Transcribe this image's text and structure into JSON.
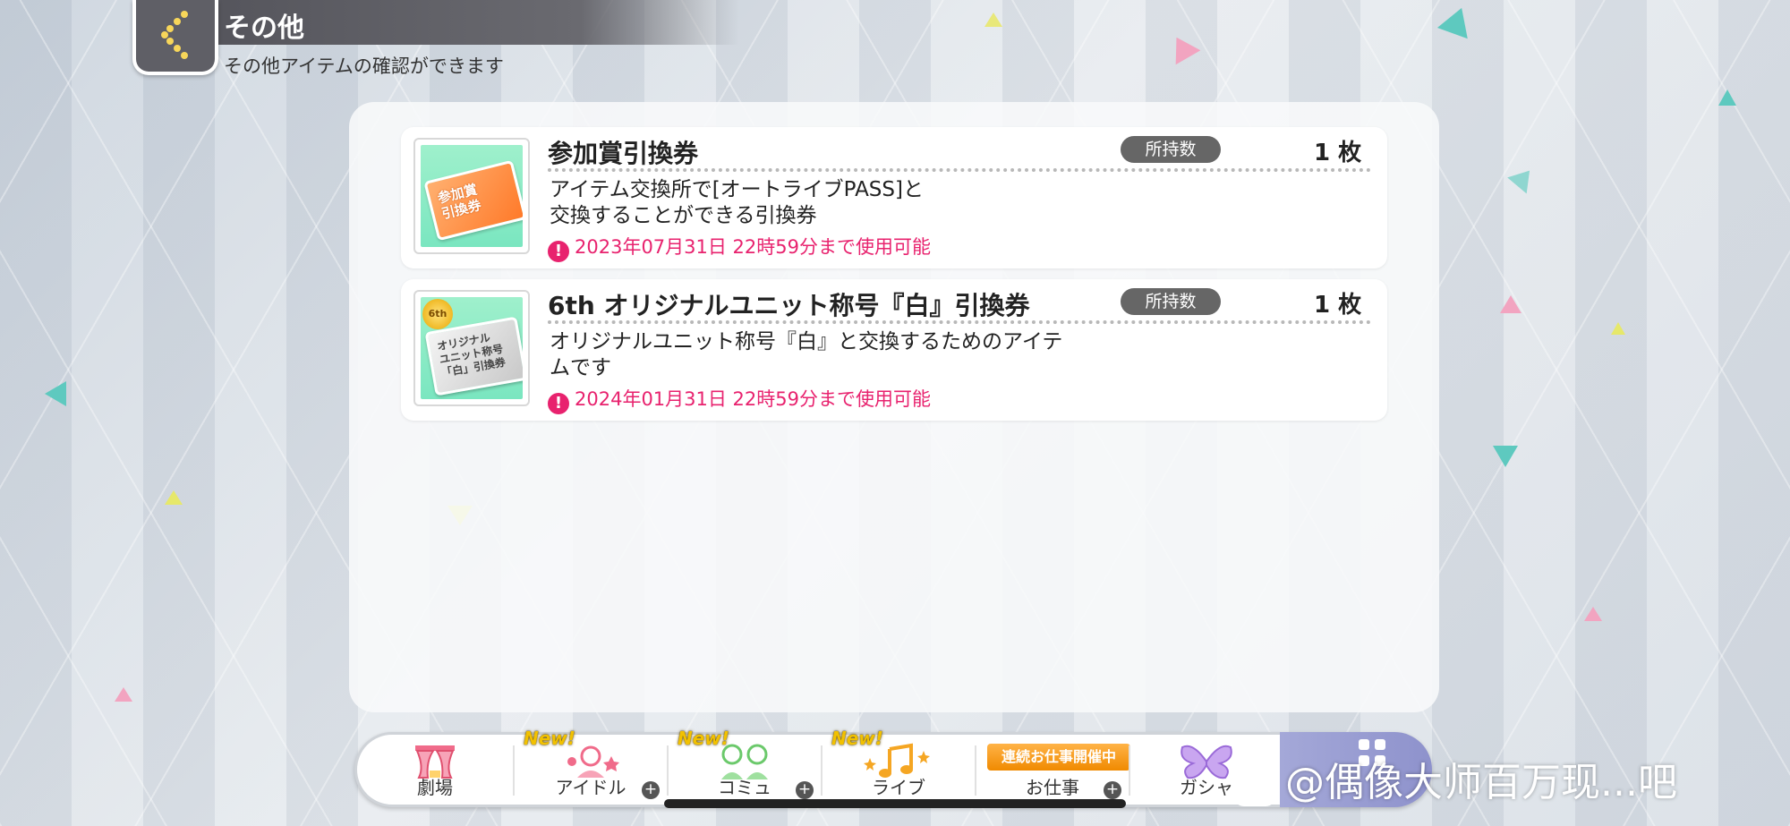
{
  "header": {
    "title": "その他",
    "subtitle": "その他アイテムの確認ができます"
  },
  "items": [
    {
      "name": "参加賞引換券",
      "held_label": "所持数",
      "count": "1 枚",
      "description_line1": "アイテム交換所で[オートライブPASS]と",
      "description_line2": "交換することができる引換券",
      "expiry": "2023年07月31日 22時59分まで使用可能",
      "thumb_text": "参加賞\n引換券",
      "icon": "ticket-icon"
    },
    {
      "name": "6th オリジナルユニット称号『白』引換券",
      "held_label": "所持数",
      "count": "1 枚",
      "description_line1": "オリジナルユニット称号『白』と交換するためのアイテ",
      "description_line2": "ムです",
      "expiry": "2024年01月31日 22時59分まで使用可能",
      "thumb_text": "オリジナル\nユニット称号\n「白」引換券",
      "thumb_badge": "6th",
      "icon": "ticket-icon"
    }
  ],
  "nav": {
    "items": [
      {
        "label": "劇場",
        "icon": "theater-icon"
      },
      {
        "label": "アイドル",
        "icon": "idol-icon",
        "new": "New!"
      },
      {
        "label": "コミュ",
        "icon": "commu-icon",
        "new": "New!"
      },
      {
        "label": "ライブ",
        "icon": "music-note-icon",
        "new": "New!"
      },
      {
        "label": "お仕事",
        "icon": "job-icon",
        "banner": "連続お仕事開催中"
      },
      {
        "label": "ガシャ",
        "icon": "butterfly-icon"
      }
    ]
  },
  "watermark": "@偶像大师百万现...吧",
  "colors": {
    "accent_pink": "#e8226e",
    "header_gray": "#5f5f66",
    "more_button": "#9a9ed2"
  }
}
